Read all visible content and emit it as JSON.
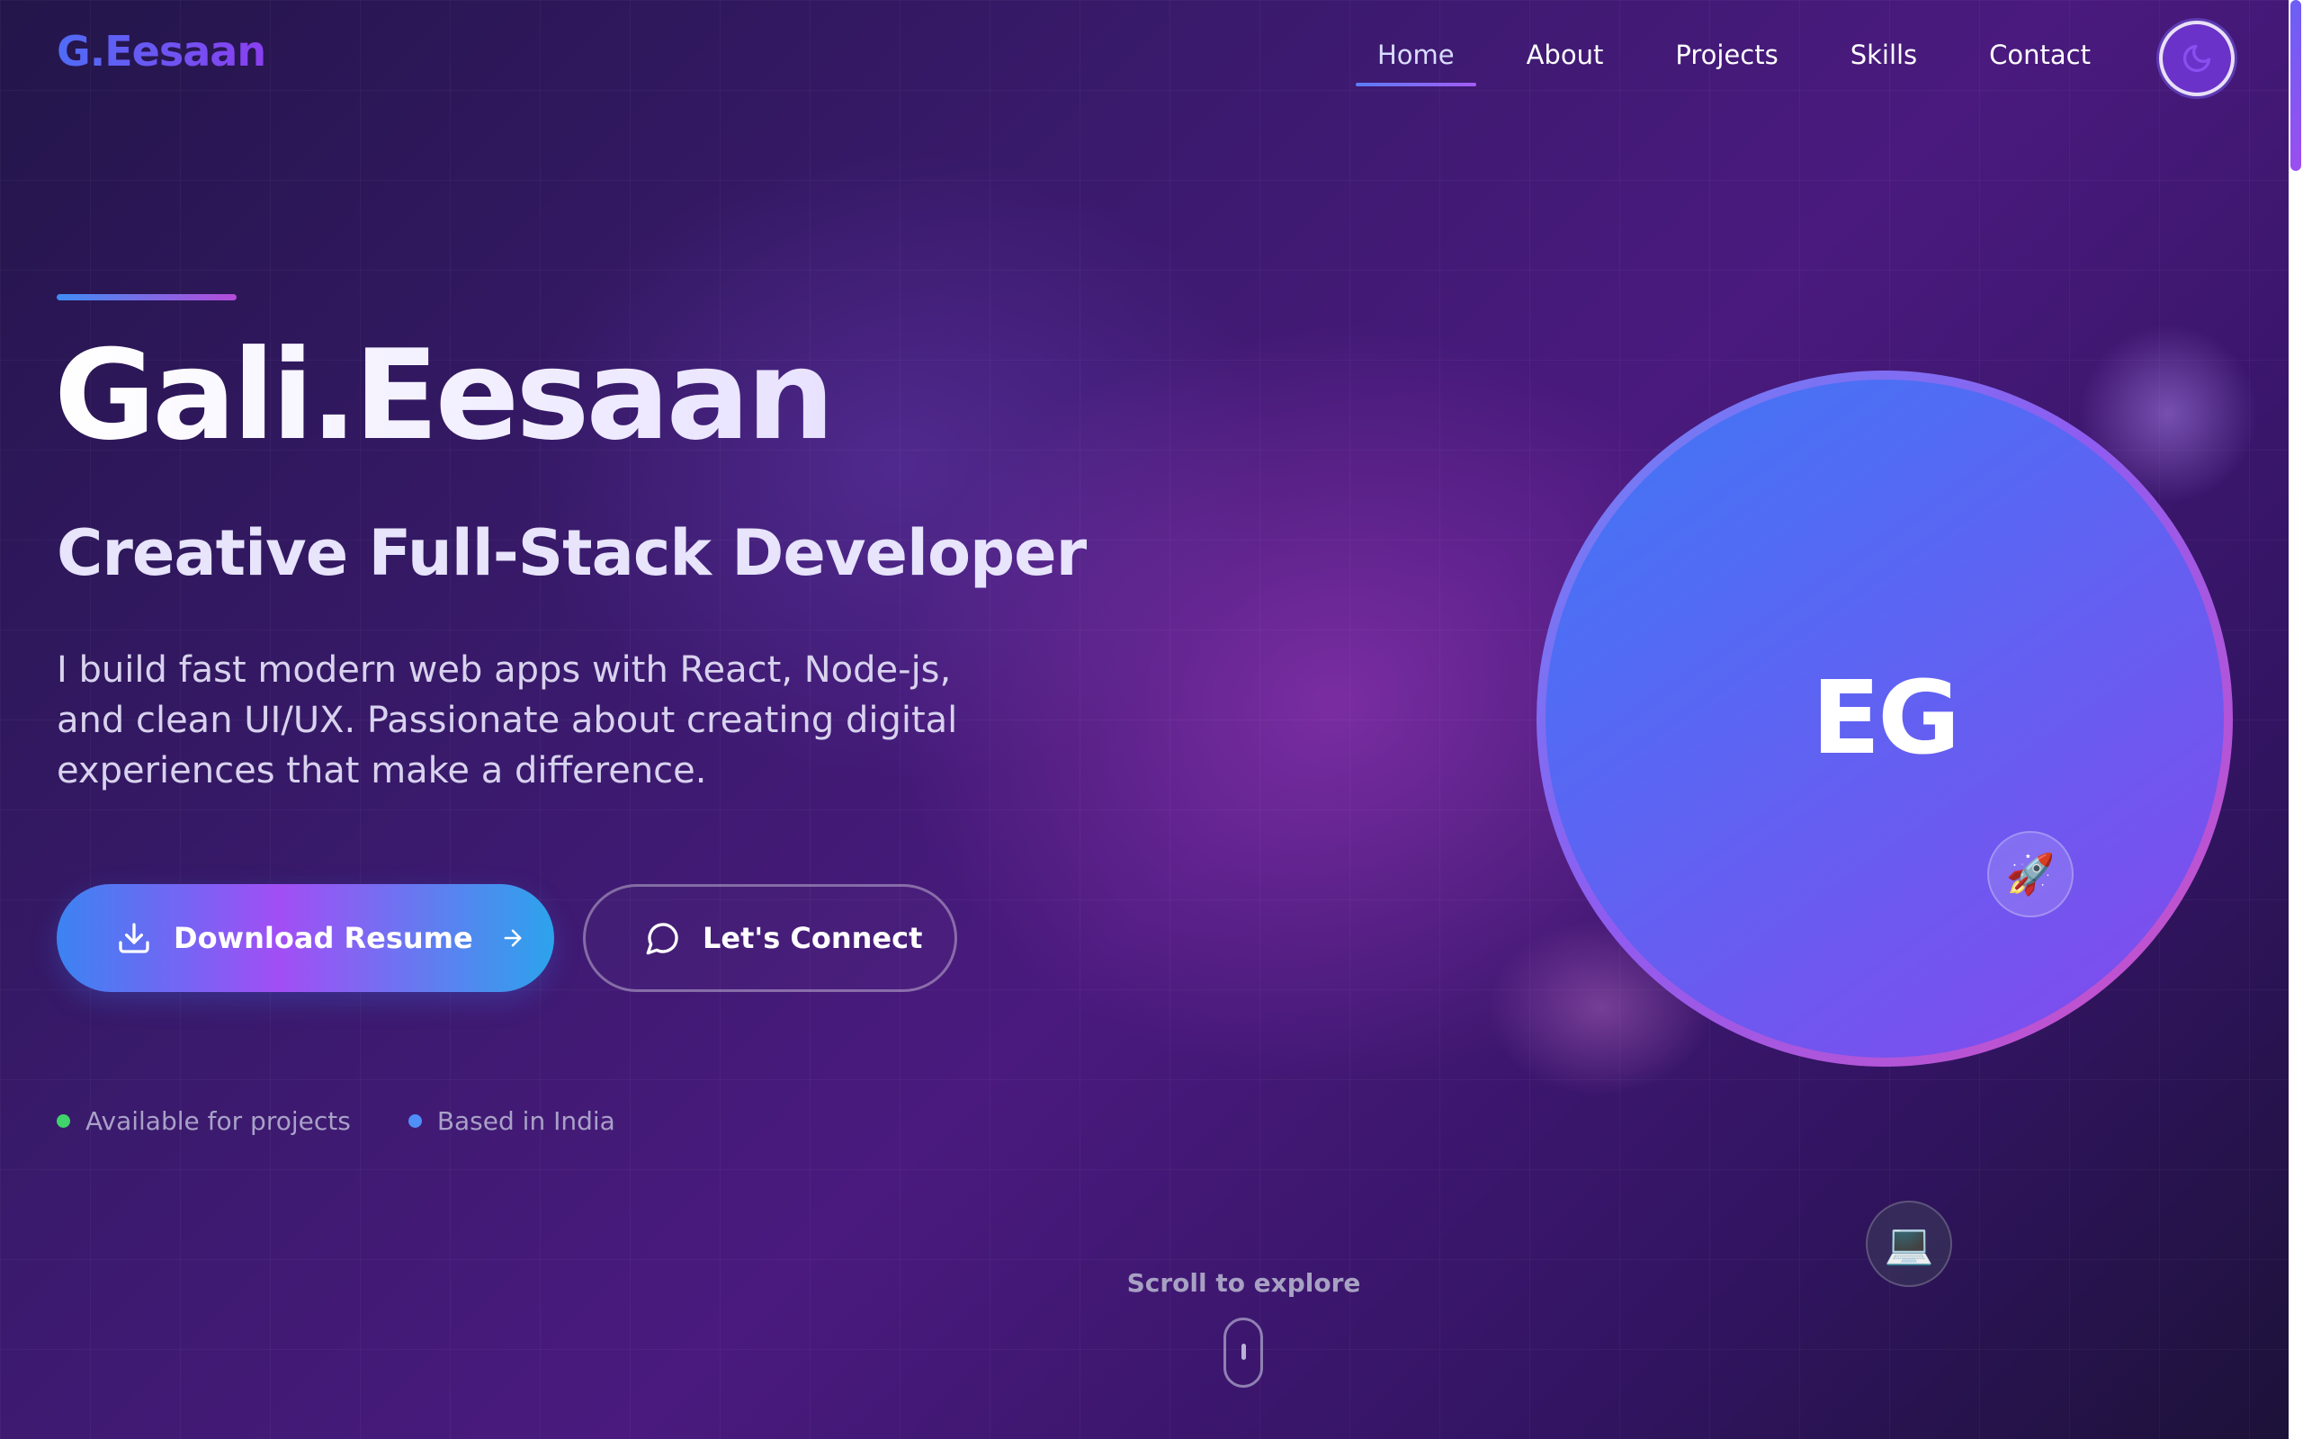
{
  "header": {
    "logo": "G.Eesaan",
    "nav": [
      {
        "label": "Home",
        "active": true
      },
      {
        "label": "About",
        "active": false
      },
      {
        "label": "Projects",
        "active": false
      },
      {
        "label": "Skills",
        "active": false
      },
      {
        "label": "Contact",
        "active": false
      }
    ],
    "theme_toggle_icon": "moon-icon"
  },
  "hero": {
    "name": "Gali.Eesaan",
    "role": "Creative Full-Stack Developer",
    "description": "I build fast modern web apps with React, Node-js, and clean UI/UX. Passionate about creating digital experiences that make a difference.",
    "primary_button": {
      "label": "Download Resume",
      "icon": "download-icon",
      "trailing_icon": "arrow-right-icon"
    },
    "secondary_button": {
      "label": "Let's Connect",
      "icon": "chat-bubble-icon"
    },
    "status": [
      {
        "label": "Available for projects",
        "color": "#3fd36b"
      },
      {
        "label": "Based in India",
        "color": "#4f8ff7"
      }
    ]
  },
  "avatar": {
    "initials": "EG",
    "badges": [
      {
        "icon": "rocket-icon",
        "glyph": "🚀"
      },
      {
        "icon": "laptop-icon",
        "glyph": "💻"
      }
    ]
  },
  "scroll": {
    "label": "Scroll to explore"
  },
  "colors": {
    "accent_blue": "#3f77f5",
    "accent_purple": "#8548ec",
    "accent_pink": "#d04fc4"
  }
}
